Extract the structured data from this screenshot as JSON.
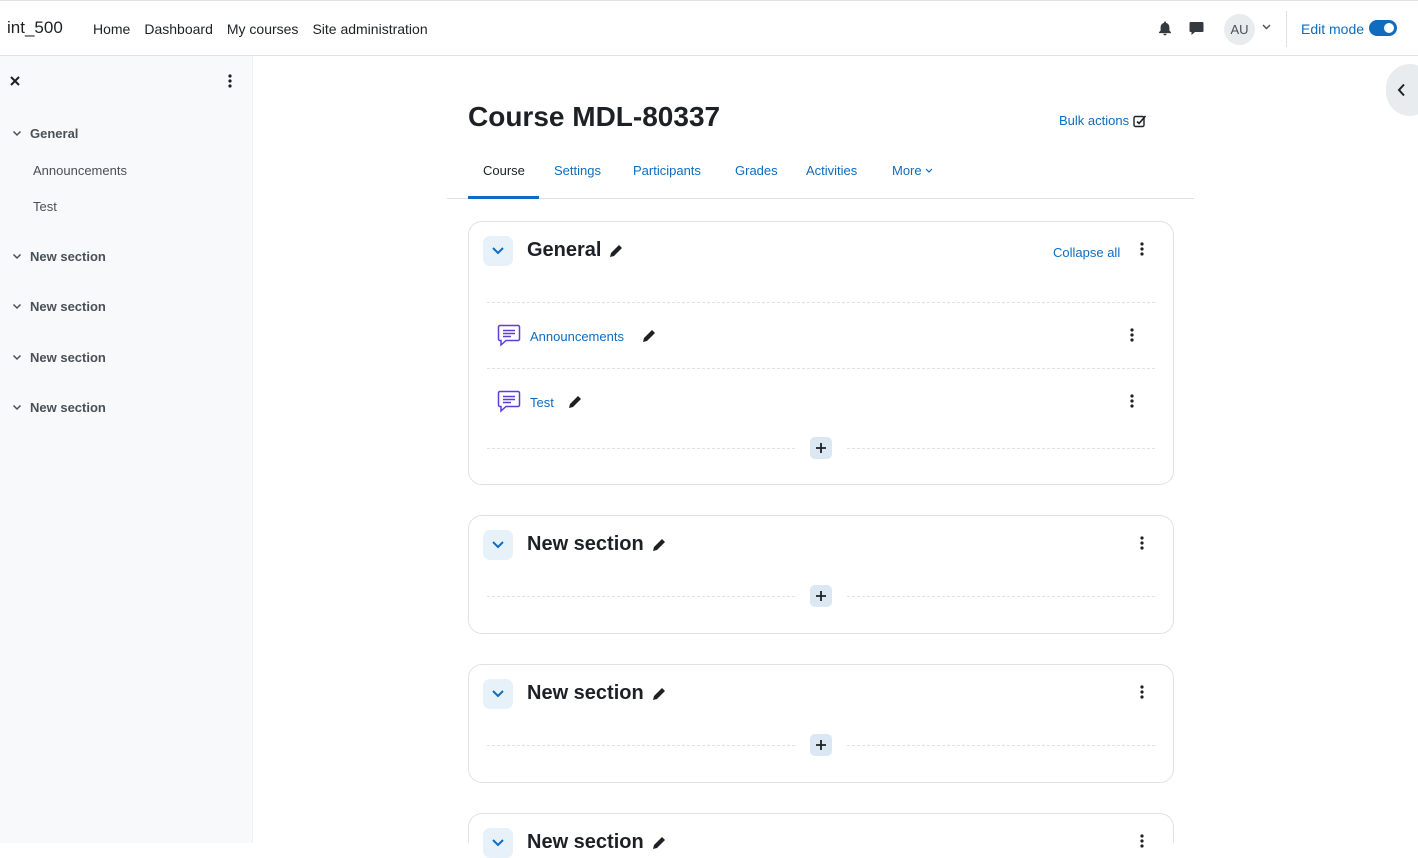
{
  "navbar": {
    "brand": "int_500",
    "links": [
      "Home",
      "Dashboard",
      "My courses",
      "Site administration"
    ],
    "avatar_initials": "AU",
    "edit_mode_label": "Edit mode",
    "edit_mode_on": true,
    "icons": [
      "bell-icon",
      "chat-icon",
      "chevron-down-icon"
    ]
  },
  "drawer": {
    "sections": [
      {
        "label": "General",
        "items": [
          "Announcements",
          "Test"
        ]
      },
      {
        "label": "New section",
        "items": []
      },
      {
        "label": "New section",
        "items": []
      },
      {
        "label": "New section",
        "items": []
      },
      {
        "label": "New section",
        "items": []
      }
    ]
  },
  "page": {
    "title": "Course MDL-80337",
    "bulk_actions": "Bulk actions",
    "tabs": [
      "Course",
      "Settings",
      "Participants",
      "Grades",
      "Activities",
      "More"
    ],
    "active_tab": "Course"
  },
  "course": {
    "collapse_all": "Collapse all",
    "sections": [
      {
        "title": "General",
        "activities": [
          "Announcements",
          "Test"
        ]
      },
      {
        "title": "New section",
        "activities": []
      },
      {
        "title": "New section",
        "activities": []
      },
      {
        "title": "New section",
        "activities": []
      }
    ]
  },
  "colors": {
    "accent": "#0f6cbf",
    "forum_icon": "#5b3fd6",
    "drawer_bg": "#f8f9fa"
  }
}
